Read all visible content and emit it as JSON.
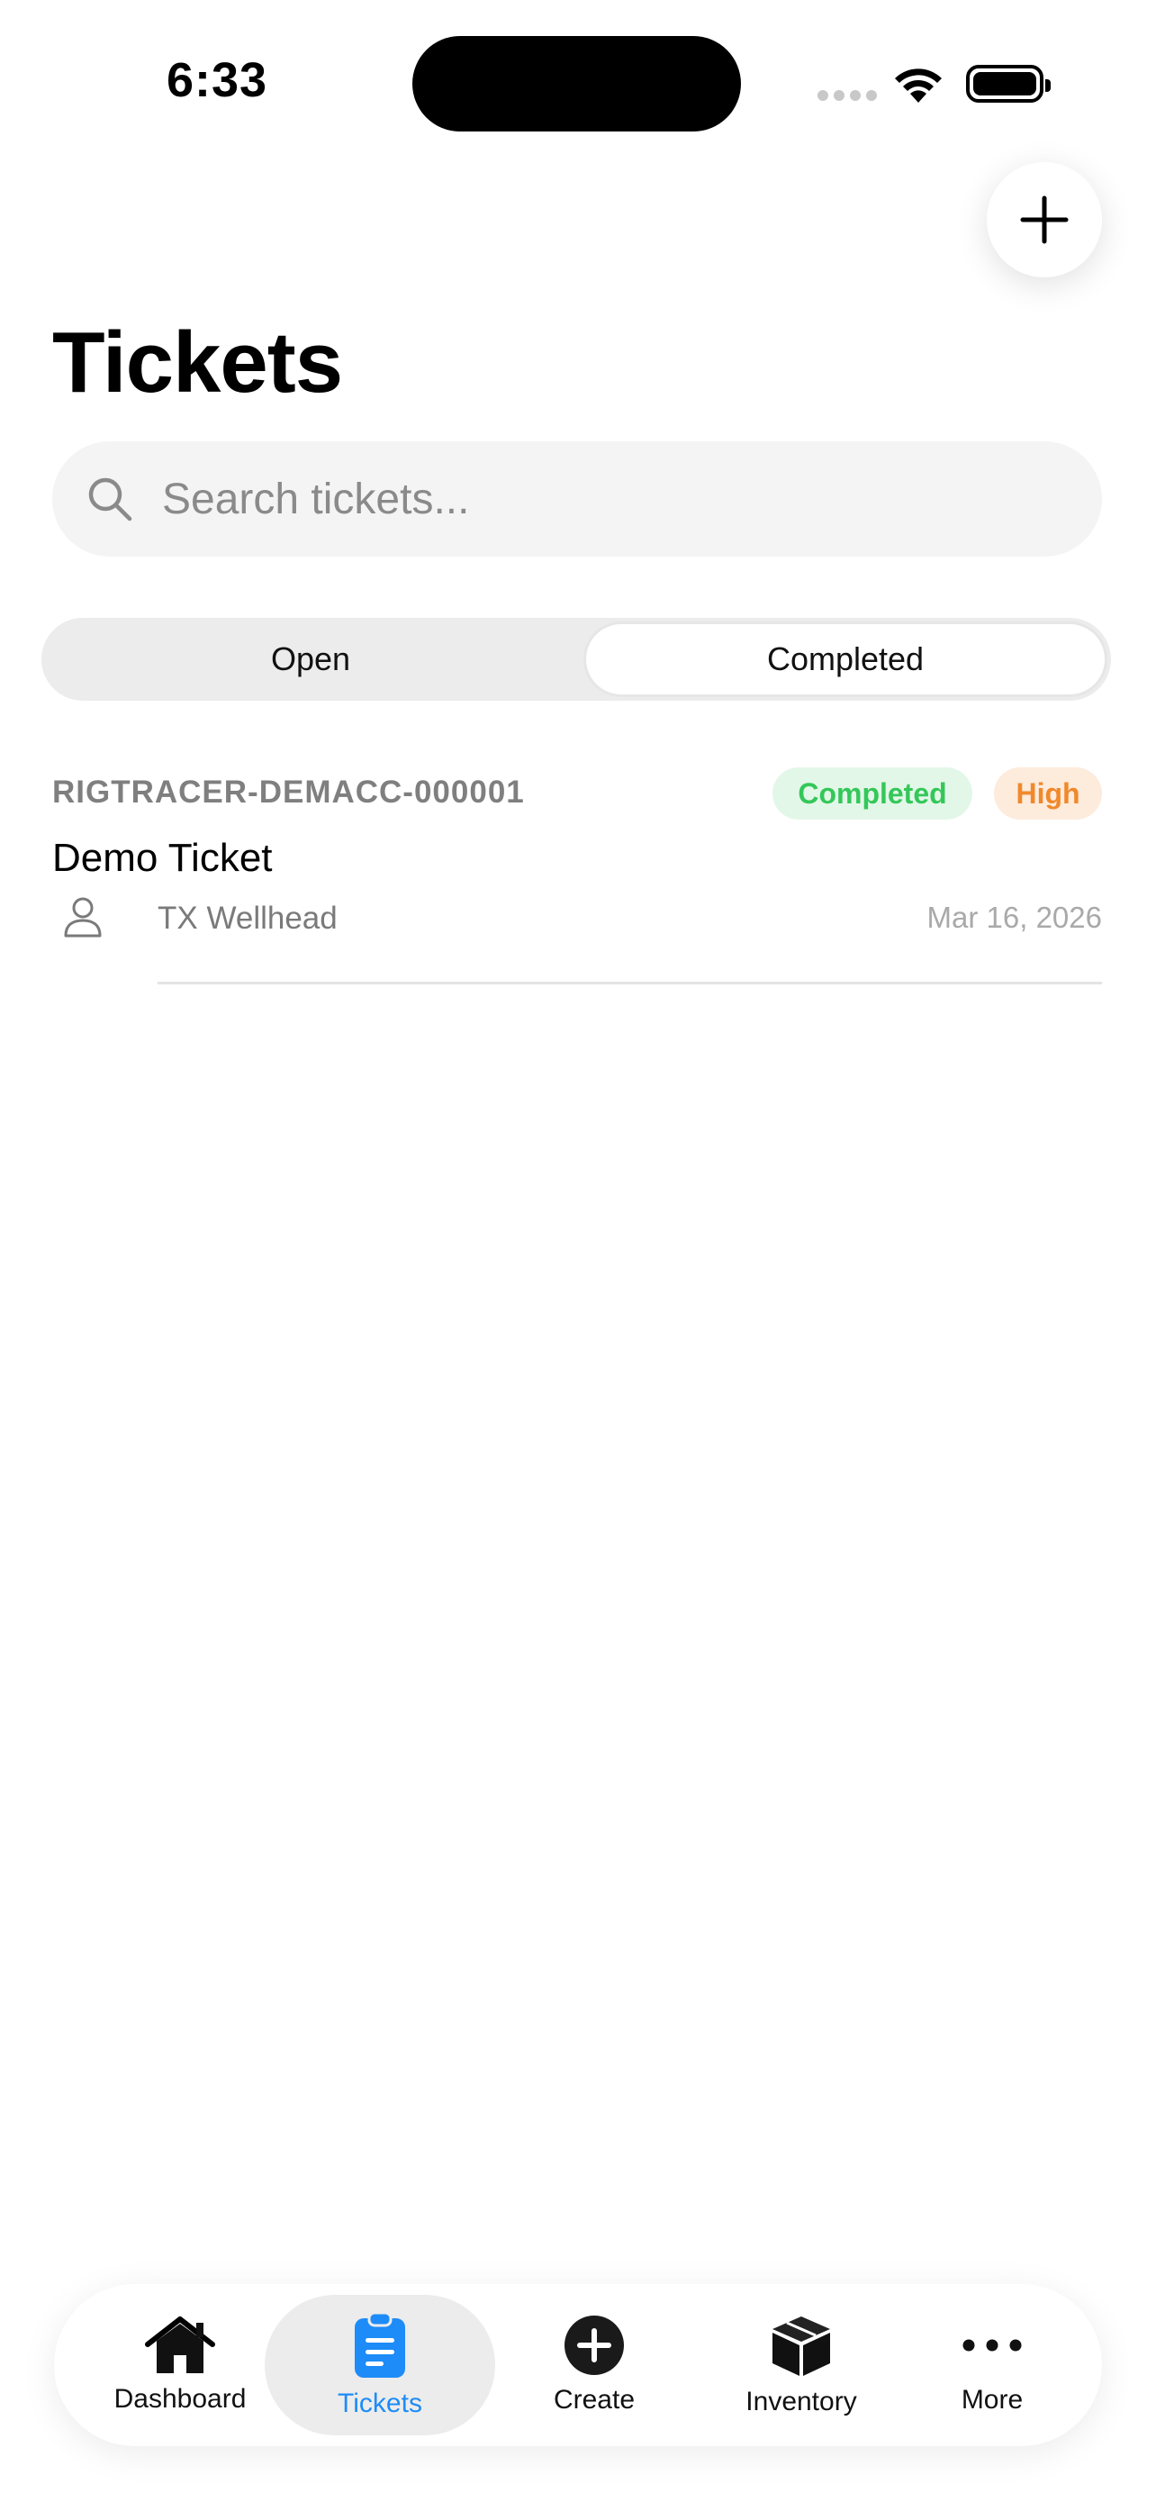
{
  "status_bar": {
    "time": "6:33"
  },
  "header": {
    "title": "Tickets",
    "add_icon": "plus-icon"
  },
  "search": {
    "placeholder": "Search tickets...",
    "value": ""
  },
  "segments": [
    {
      "label": "Open",
      "selected": false
    },
    {
      "label": "Completed",
      "selected": true
    }
  ],
  "tickets": [
    {
      "id": "RIGTRACER-DEMACC-000001",
      "status": "Completed",
      "priority": "High",
      "title": "Demo Ticket",
      "location": "TX Wellhead",
      "date": "Mar 16, 2026"
    }
  ],
  "tab_bar": {
    "items": [
      {
        "label": "Dashboard",
        "icon": "house-icon",
        "active": false
      },
      {
        "label": "Tickets",
        "icon": "clipboard-icon",
        "active": true
      },
      {
        "label": "Create",
        "icon": "plus-circle-icon",
        "active": false
      },
      {
        "label": "Inventory",
        "icon": "box-icon",
        "active": false
      },
      {
        "label": "More",
        "icon": "ellipsis-icon",
        "active": false
      }
    ]
  },
  "colors": {
    "accent": "#1d8cf8",
    "status_completed_text": "#34c759",
    "status_completed_bg": "#e3f7e8",
    "priority_high_text": "#f0892b",
    "priority_high_bg": "#fdebdc"
  }
}
